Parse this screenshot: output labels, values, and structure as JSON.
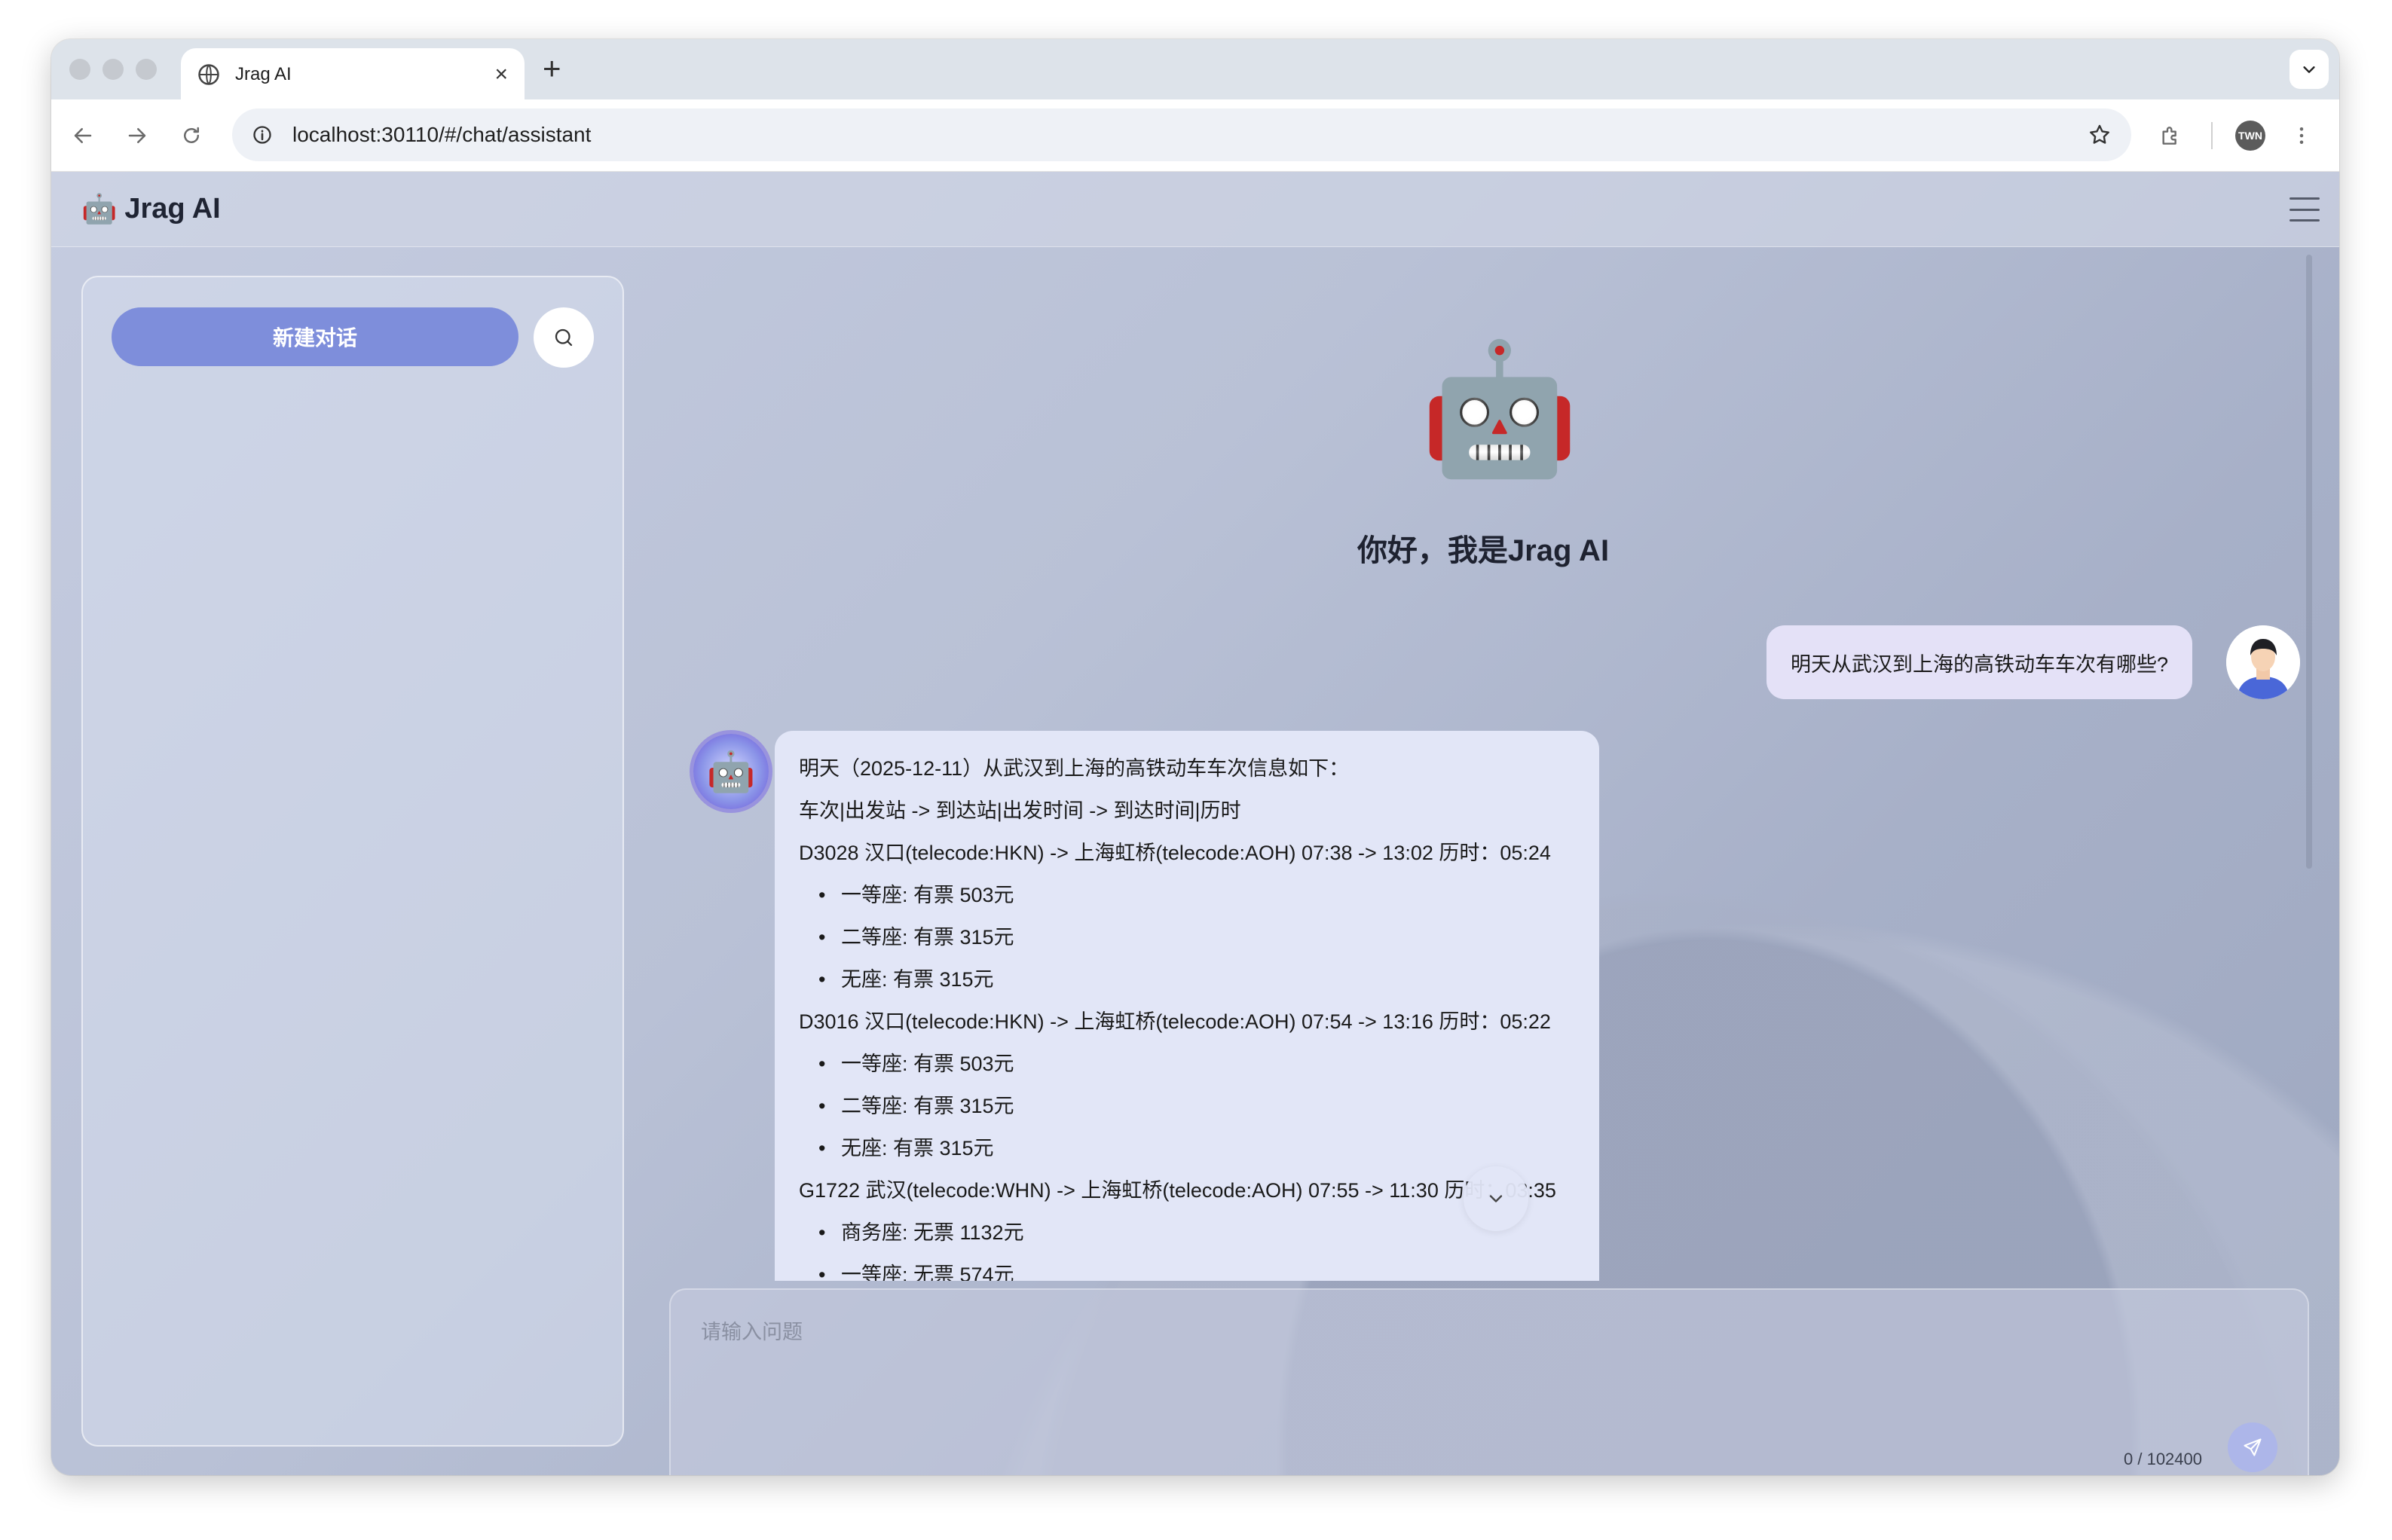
{
  "browser": {
    "tab_title": "Jrag AI",
    "url": "localhost:30110/#/chat/assistant",
    "profile_initials": "TWN"
  },
  "app": {
    "logo_emoji": "🤖",
    "brand": "Jrag AI",
    "sidebar": {
      "new_chat_label": "新建对话"
    },
    "hero": {
      "emoji": "🤖",
      "greeting": "你好，我是Jrag AI"
    },
    "user_message": "明天从武汉到上海的高铁动车车次有哪些?",
    "bot_avatar_emoji": "🤖",
    "bot_message": {
      "lines": [
        {
          "type": "text",
          "text": "明天（2025-12-11）从武汉到上海的高铁动车车次信息如下："
        },
        {
          "type": "text",
          "text": "车次|出发站 -> 到达站|出发时间 -> 到达时间|历时"
        },
        {
          "type": "text",
          "text": "D3028 汉口(telecode:HKN) -> 上海虹桥(telecode:AOH) 07:38 -> 13:02 历时：05:24"
        },
        {
          "type": "bullet",
          "text": "一等座: 有票 503元"
        },
        {
          "type": "bullet",
          "text": "二等座: 有票 315元"
        },
        {
          "type": "bullet",
          "text": "无座: 有票 315元"
        },
        {
          "type": "text",
          "text": "D3016 汉口(telecode:HKN) -> 上海虹桥(telecode:AOH) 07:54 -> 13:16 历时：05:22"
        },
        {
          "type": "bullet",
          "text": "一等座: 有票 503元"
        },
        {
          "type": "bullet",
          "text": "二等座: 有票 315元"
        },
        {
          "type": "bullet",
          "text": "无座: 有票 315元"
        },
        {
          "type": "text",
          "text": "G1722 武汉(telecode:WHN) -> 上海虹桥(telecode:AOH) 07:55 -> 11:30 历时：03:35"
        },
        {
          "type": "bullet",
          "text": "商务座: 无票 1132元"
        },
        {
          "type": "bullet",
          "text": "一等座: 无票 574元"
        }
      ]
    },
    "composer": {
      "placeholder": "请输入问题",
      "counter": "0 / 102400"
    }
  },
  "colors": {
    "new_chat_button": "#7e8edb",
    "user_bubble": "#e4e1f7",
    "bot_bubble": "#e2e6f7"
  }
}
